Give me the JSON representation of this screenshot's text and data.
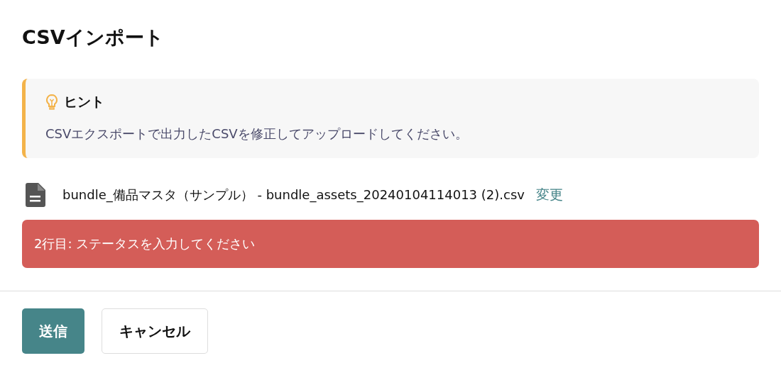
{
  "title": "CSVインポート",
  "hint": {
    "heading": "ヒント",
    "body": "CSVエクスポートで出力したCSVを修正してアップロードしてください。"
  },
  "file": {
    "name": "bundle_備品マスタ（サンプル） - bundle_assets_20240104114013 (2).csv",
    "change_link": "変更"
  },
  "errors": [
    "2行目: ステータスを入力してください"
  ],
  "buttons": [
    {
      "label": "送信",
      "kind": "primary"
    },
    {
      "label": "キャンセル",
      "kind": "secondary"
    }
  ]
}
